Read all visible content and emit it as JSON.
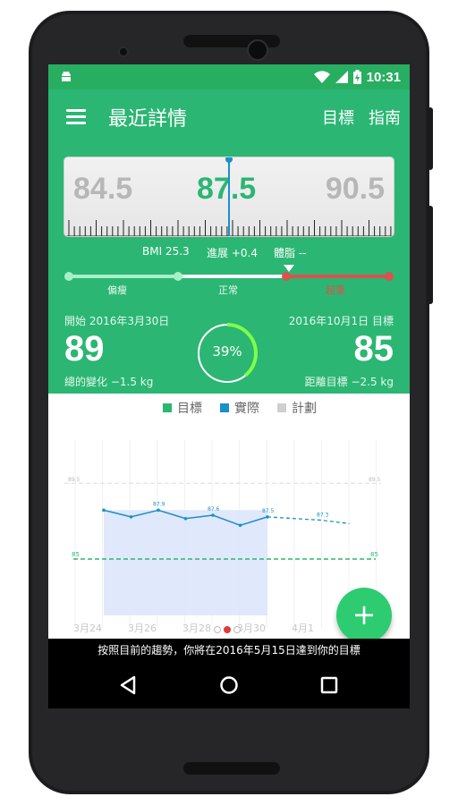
{
  "status_bar": {
    "time": "10:31"
  },
  "app_bar": {
    "title": "最近詳情",
    "action_target": "目標",
    "action_guide": "指南"
  },
  "ruler": {
    "left_value": "84.5",
    "center_value": "87.5",
    "right_value": "90.5"
  },
  "stats": {
    "bmi": "BMI 25.3",
    "progress": "進展 +0.4",
    "body_fat": "體脂 --"
  },
  "bmi_scale": {
    "labels": [
      "偏瘦",
      "正常",
      "超重"
    ],
    "colors": {
      "under": "#a7f0c7",
      "normal": "#ffffff",
      "over": "#d9534f"
    }
  },
  "summary": {
    "start_label": "開始 2016年3月30日",
    "end_label": "2016年10月1日 目標",
    "start_weight": "89",
    "target_weight": "85",
    "total_change": "總的變化 −1.5 kg",
    "remaining": "距離目標 −2.5 kg",
    "progress_percent": "39%",
    "progress_fraction": 0.39
  },
  "legend": [
    {
      "label": "目標",
      "color": "#2bb673"
    },
    {
      "label": "實際",
      "color": "#1b8fc8"
    },
    {
      "label": "計劃",
      "color": "#cfcfcf"
    }
  ],
  "chart_data": {
    "type": "line",
    "x": [
      "3月24",
      "3月25",
      "3月26",
      "3月27",
      "3月28",
      "3月29",
      "3月30",
      "3月31",
      "4月1",
      "4月2"
    ],
    "x_tick_labels": [
      "3月24",
      "3月26",
      "3月28",
      "3月30",
      "4月1"
    ],
    "series": [
      {
        "name": "實際",
        "values": [
          87.9,
          87.5,
          87.9,
          87.4,
          87.6,
          87.0,
          87.5
        ],
        "point_labels": [
          "",
          "",
          "87.9",
          "",
          "87.6",
          "",
          "87.5"
        ]
      },
      {
        "name": "計劃",
        "values": [
          null,
          null,
          null,
          null,
          null,
          null,
          87.5,
          87.4,
          87.3,
          87.1
        ],
        "point_labels": [
          "",
          "",
          "",
          "",
          "",
          "",
          "",
          "",
          "87.3",
          ""
        ]
      },
      {
        "name": "目標",
        "values": [
          85,
          85,
          85,
          85,
          85,
          85,
          85,
          85,
          85,
          85
        ],
        "edge_label": "85"
      }
    ],
    "reference_line_label": "89.5",
    "ylim": [
      82.5,
      91
    ]
  },
  "pager": {
    "pages": 3,
    "active": 1
  },
  "toast": {
    "text": "按照目前的趨勢，你將在2016年5月15日達到你的目標"
  }
}
